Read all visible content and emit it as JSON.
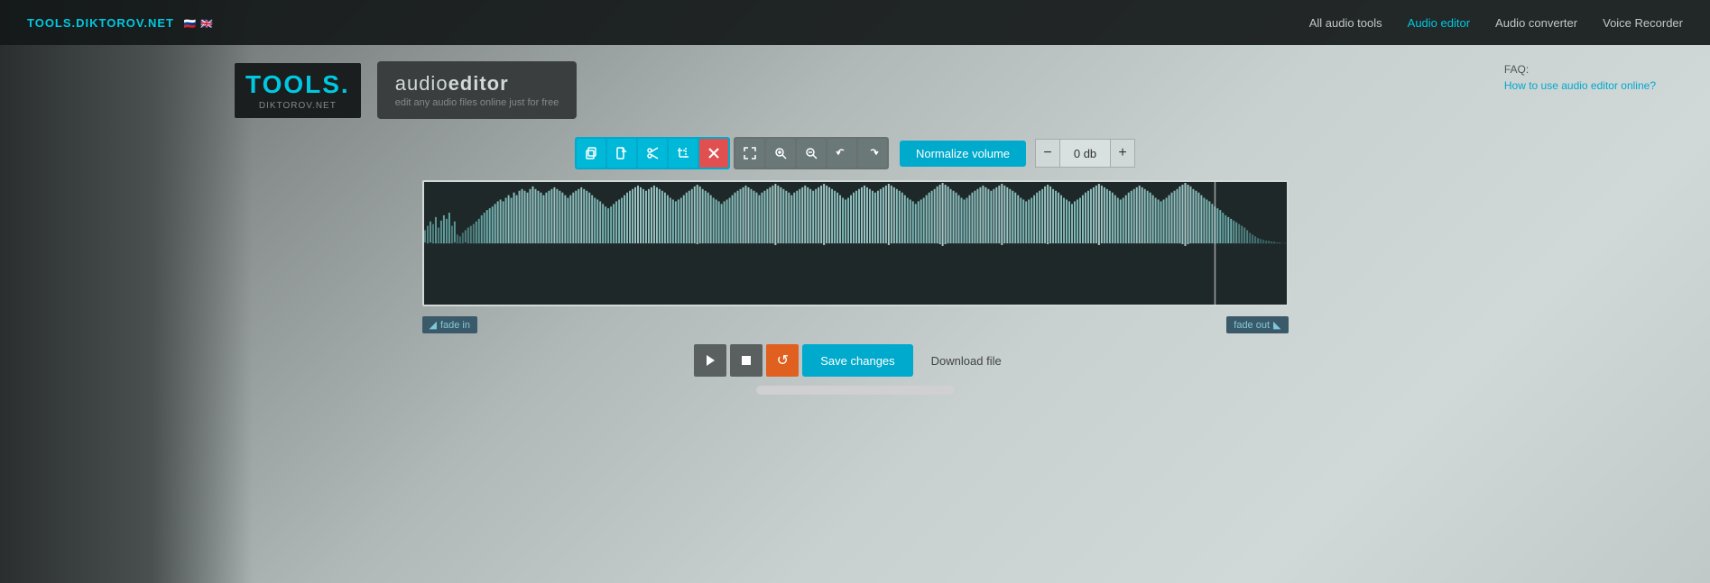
{
  "brand": {
    "site_name": "TOOLS.DIKTOROV.NET",
    "flags": "🇷🇺 🇬🇧",
    "logo_text": "TOOLS.",
    "logo_sub": "DIKTOROV.NET"
  },
  "navbar": {
    "links": [
      {
        "label": "All audio tools",
        "active": false
      },
      {
        "label": "Audio editor",
        "active": true
      },
      {
        "label": "Audio converter",
        "active": false
      },
      {
        "label": "Voice Recorder",
        "active": false
      }
    ]
  },
  "header": {
    "audio_editor_title": "audioeditor",
    "audio_editor_subtitle": "edit any audio files online just for free"
  },
  "faq": {
    "label": "FAQ:",
    "link_text": "How to use audio editor online?"
  },
  "toolbar": {
    "group1_buttons": [
      "copy",
      "file",
      "scissors",
      "crop",
      "close"
    ],
    "group2_buttons": [
      "expand",
      "zoom-in",
      "zoom-out",
      "undo",
      "redo"
    ],
    "normalize_label": "Normalize volume",
    "volume_minus": "−",
    "volume_value": "0 db",
    "volume_plus": "+"
  },
  "waveform": {
    "fade_in_label": "fade in",
    "fade_out_label": "fade out"
  },
  "playback": {
    "play_label": "▶",
    "stop_label": "■",
    "refresh_label": "↺",
    "save_label": "Save changes",
    "download_label": "Download file"
  },
  "colors": {
    "accent": "#00aacc",
    "orange": "#e06020",
    "toolbar_bg": "#00aacc",
    "toolbar_gray": "#6a7878",
    "waveform_bg": "#1e2828",
    "waveform_wave": "#4a8090",
    "waveform_selection": "#80c0d0"
  }
}
